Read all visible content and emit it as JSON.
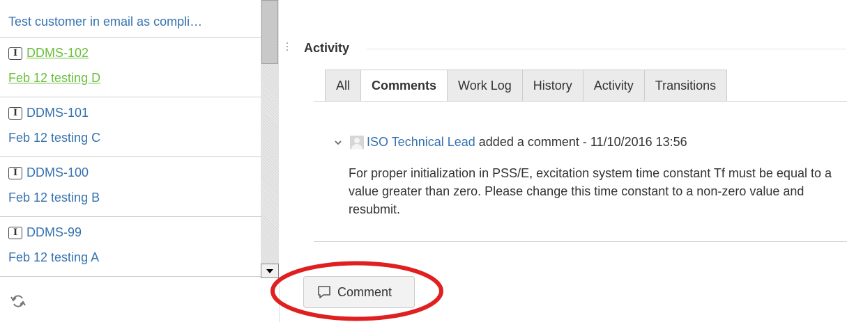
{
  "issue_list": {
    "truncated_item": {
      "summary": "Test customer in email as compli…"
    },
    "items": [
      {
        "key": "DDMS-102",
        "summary": "Feb 12 testing D",
        "type_icon": "issue-type-icon"
      },
      {
        "key": "DDMS-101",
        "summary": "Feb 12 testing C",
        "type_icon": "issue-type-icon"
      },
      {
        "key": "DDMS-100",
        "summary": "Feb 12 testing B",
        "type_icon": "issue-type-icon"
      },
      {
        "key": "DDMS-99",
        "summary": "Feb 12 testing A",
        "type_icon": "issue-type-icon"
      }
    ],
    "active_color": "#6abf3c",
    "link_color": "#3572b0"
  },
  "activity": {
    "heading": "Activity",
    "tabs": [
      {
        "label": "All"
      },
      {
        "label": "Comments"
      },
      {
        "label": "Work Log"
      },
      {
        "label": "History"
      },
      {
        "label": "Activity"
      },
      {
        "label": "Transitions"
      }
    ],
    "active_tab": "Comments",
    "comment": {
      "author": "ISO Technical Lead",
      "action": "added a comment",
      "separator": "-",
      "date": "11/10/2016 13:56",
      "body": "For proper initialization in PSS/E, excitation system time constant Tf must be equal to a value greater than zero. Please change this time constant to a non-zero value and resubmit."
    },
    "comment_button_label": "Comment"
  },
  "icons": {
    "refresh": "refresh-icon",
    "collapse": "chevron-down-icon",
    "avatar": "avatar",
    "comment": "speech-bubble-icon"
  },
  "annotation": {
    "color": "#e02020",
    "shape": "ellipse"
  }
}
